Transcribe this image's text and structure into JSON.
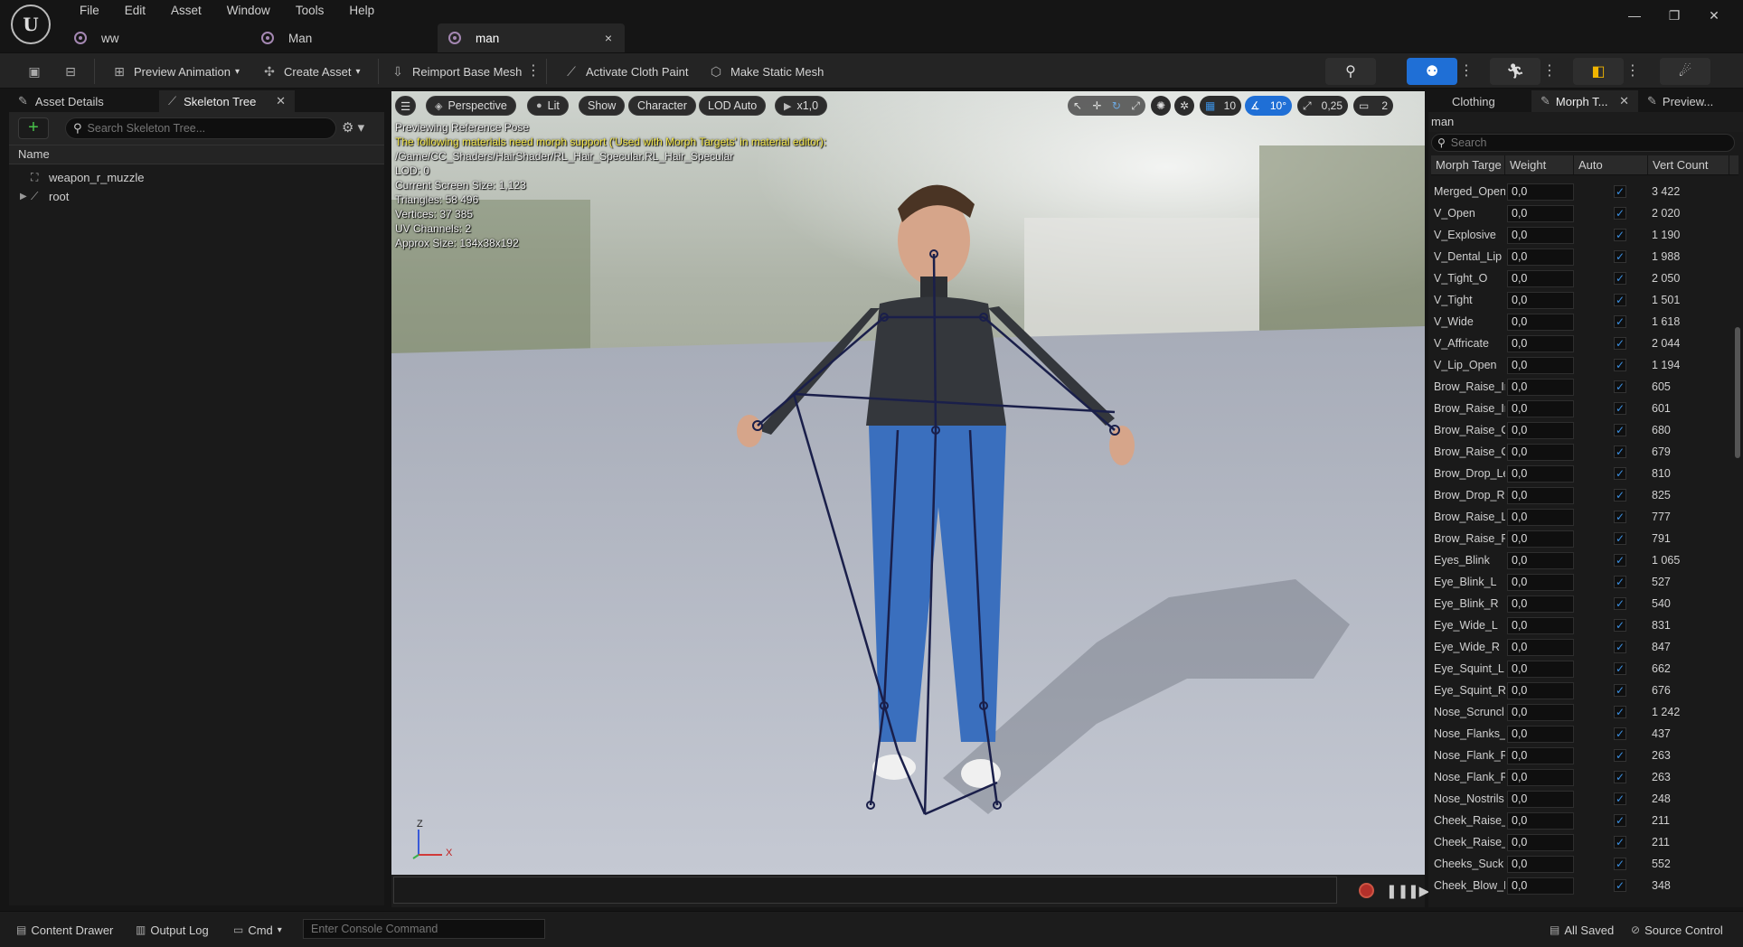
{
  "menu": [
    "File",
    "Edit",
    "Asset",
    "Window",
    "Tools",
    "Help"
  ],
  "doc_tabs": [
    {
      "label": "ww"
    },
    {
      "label": "Man"
    },
    {
      "label": "man",
      "close": "×"
    }
  ],
  "window_controls": {
    "minimize": "—",
    "restore": "❐",
    "close": "✕"
  },
  "toolbar": {
    "preview_animation": "Preview Animation",
    "create_asset": "Create Asset",
    "reimport": "Reimport Base Mesh",
    "cloth_paint": "Activate Cloth Paint",
    "static_mesh": "Make Static Mesh"
  },
  "left_panel": {
    "tab_asset_details": "Asset Details",
    "tab_skeleton_tree": "Skeleton Tree",
    "search_placeholder": "Search Skeleton Tree...",
    "column_name": "Name",
    "tree": [
      {
        "label": "weapon_r_muzzle"
      },
      {
        "label": "root"
      }
    ]
  },
  "viewport": {
    "perspective": "Perspective",
    "lit": "Lit",
    "show": "Show",
    "character": "Character",
    "lod": "LOD Auto",
    "speed": "x1,0",
    "grid": "10",
    "angle": "10°",
    "scale": "0,25",
    "camera": "2",
    "info": {
      "line1": "Previewing Reference Pose",
      "warn": "The following materials need morph support ('Used with Morph Targets' in material editor):",
      "path": "/Game/CC_Shaders/HairShader/RL_Hair_Specular.RL_Hair_Specular",
      "lod": "LOD: 0",
      "screen": "Current Screen Size: 1,123",
      "tris": "Triangles: 58 496",
      "verts": "Vertices: 37 385",
      "uv": "UV Channels: 2",
      "size": "Approx Size: 134x38x192"
    },
    "axis": {
      "z": "Z",
      "x": "X"
    }
  },
  "right_panel": {
    "tab_clothing": "Clothing",
    "tab_morph": "Morph T...",
    "tab_preview": "Preview...",
    "label": "man",
    "search_placeholder": "Search",
    "columns": [
      "Morph Targe",
      "Weight",
      "Auto",
      "Vert Count"
    ],
    "rows": [
      {
        "name": "Merged_Open",
        "weight": "0,0",
        "vert": "3 422"
      },
      {
        "name": "V_Open",
        "weight": "0,0",
        "vert": "2 020"
      },
      {
        "name": "V_Explosive",
        "weight": "0,0",
        "vert": "1 190"
      },
      {
        "name": "V_Dental_Lip",
        "weight": "0,0",
        "vert": "1 988"
      },
      {
        "name": "V_Tight_O",
        "weight": "0,0",
        "vert": "2 050"
      },
      {
        "name": "V_Tight",
        "weight": "0,0",
        "vert": "1 501"
      },
      {
        "name": "V_Wide",
        "weight": "0,0",
        "vert": "1 618"
      },
      {
        "name": "V_Affricate",
        "weight": "0,0",
        "vert": "2 044"
      },
      {
        "name": "V_Lip_Open",
        "weight": "0,0",
        "vert": "1 194"
      },
      {
        "name": "Brow_Raise_Ir",
        "weight": "0,0",
        "vert": "605"
      },
      {
        "name": "Brow_Raise_Ir",
        "weight": "0,0",
        "vert": "601"
      },
      {
        "name": "Brow_Raise_C",
        "weight": "0,0",
        "vert": "680"
      },
      {
        "name": "Brow_Raise_C",
        "weight": "0,0",
        "vert": "679"
      },
      {
        "name": "Brow_Drop_Le",
        "weight": "0,0",
        "vert": "810"
      },
      {
        "name": "Brow_Drop_Ri",
        "weight": "0,0",
        "vert": "825"
      },
      {
        "name": "Brow_Raise_L",
        "weight": "0,0",
        "vert": "777"
      },
      {
        "name": "Brow_Raise_F",
        "weight": "0,0",
        "vert": "791"
      },
      {
        "name": "Eyes_Blink",
        "weight": "0,0",
        "vert": "1 065"
      },
      {
        "name": "Eye_Blink_L",
        "weight": "0,0",
        "vert": "527"
      },
      {
        "name": "Eye_Blink_R",
        "weight": "0,0",
        "vert": "540"
      },
      {
        "name": "Eye_Wide_L",
        "weight": "0,0",
        "vert": "831"
      },
      {
        "name": "Eye_Wide_R",
        "weight": "0,0",
        "vert": "847"
      },
      {
        "name": "Eye_Squint_L",
        "weight": "0,0",
        "vert": "662"
      },
      {
        "name": "Eye_Squint_R",
        "weight": "0,0",
        "vert": "676"
      },
      {
        "name": "Nose_Scruncl",
        "weight": "0,0",
        "vert": "1 242"
      },
      {
        "name": "Nose_Flanks_",
        "weight": "0,0",
        "vert": "437"
      },
      {
        "name": "Nose_Flank_R",
        "weight": "0,0",
        "vert": "263"
      },
      {
        "name": "Nose_Flank_R",
        "weight": "0,0",
        "vert": "263"
      },
      {
        "name": "Nose_Nostrils",
        "weight": "0,0",
        "vert": "248"
      },
      {
        "name": "Cheek_Raise_",
        "weight": "0,0",
        "vert": "211"
      },
      {
        "name": "Cheek_Raise_",
        "weight": "0,0",
        "vert": "211"
      },
      {
        "name": "Cheeks_Suck",
        "weight": "0,0",
        "vert": "552"
      },
      {
        "name": "Cheek_Blow_L",
        "weight": "0,0",
        "vert": "348"
      }
    ]
  },
  "statusbar": {
    "content_drawer": "Content Drawer",
    "output_log": "Output Log",
    "cmd": "Cmd",
    "console_placeholder": "Enter Console Command",
    "all_saved": "All Saved",
    "source_control": "Source Control"
  },
  "colors": {
    "accent": "#1f6fd6",
    "add_green": "#48c24a",
    "warning": "#f5e84b"
  }
}
